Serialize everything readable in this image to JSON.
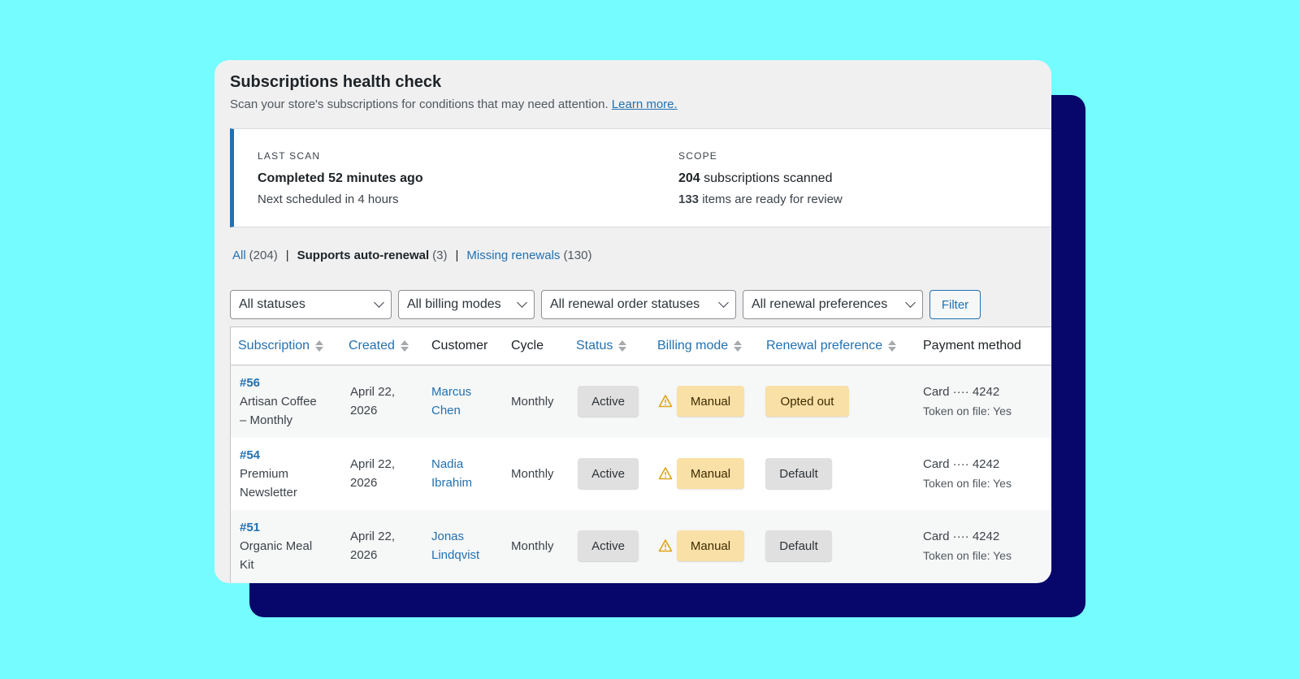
{
  "header": {
    "title": "Subscriptions health check",
    "description": "Scan your store's subscriptions for conditions that may need attention.",
    "learn_more": "Learn more."
  },
  "scan": {
    "last_scan_label": "LAST SCAN",
    "last_scan_value": "Completed 52 minutes ago",
    "next_scheduled": "Next scheduled in 4 hours",
    "scope_label": "SCOPE",
    "scanned_count": "204",
    "scanned_text": "subscriptions scanned",
    "review_count": "133",
    "review_text": "items are ready for review"
  },
  "views": {
    "all_label": "All",
    "all_count": "(204)",
    "auto_label": "Supports auto-renewal",
    "auto_count": "(3)",
    "missing_label": "Missing renewals",
    "missing_count": "(130)",
    "separator": "|"
  },
  "filters": {
    "statuses": "All statuses",
    "billing_modes": "All billing modes",
    "renewal_order_statuses": "All renewal order statuses",
    "renewal_preferences": "All renewal preferences",
    "filter_button": "Filter"
  },
  "columns": {
    "subscription": "Subscription",
    "created": "Created",
    "customer": "Customer",
    "cycle": "Cycle",
    "status": "Status",
    "billing_mode": "Billing mode",
    "renewal_preference": "Renewal preference",
    "payment_method": "Payment method"
  },
  "rows": [
    {
      "id": "#56",
      "name_line1": "Artisan Coffee",
      "name_line2": "– Monthly",
      "created_line1": "April 22,",
      "created_line2": "2026",
      "customer_line1": "Marcus",
      "customer_line2": "Chen",
      "cycle": "Monthly",
      "status": "Active",
      "billing_mode": "Manual",
      "renewal_preference": "Opted out",
      "payment_line1": "Card ···· 4242",
      "payment_line2": "Token on file: Yes"
    },
    {
      "id": "#54",
      "name_line1": "Premium",
      "name_line2": "Newsletter",
      "created_line1": "April 22,",
      "created_line2": "2026",
      "customer_line1": "Nadia",
      "customer_line2": "Ibrahim",
      "cycle": "Monthly",
      "status": "Active",
      "billing_mode": "Manual",
      "renewal_preference": "Default",
      "payment_line1": "Card ···· 4242",
      "payment_line2": "Token on file: Yes"
    },
    {
      "id": "#51",
      "name_line1": "Organic Meal",
      "name_line2": "Kit",
      "created_line1": "April 22,",
      "created_line2": "2026",
      "customer_line1": "Jonas",
      "customer_line2": "Lindqvist",
      "cycle": "Monthly",
      "status": "Active",
      "billing_mode": "Manual",
      "renewal_preference": "Default",
      "payment_line1": "Card ···· 4242",
      "payment_line2": "Token on file: Yes"
    }
  ]
}
